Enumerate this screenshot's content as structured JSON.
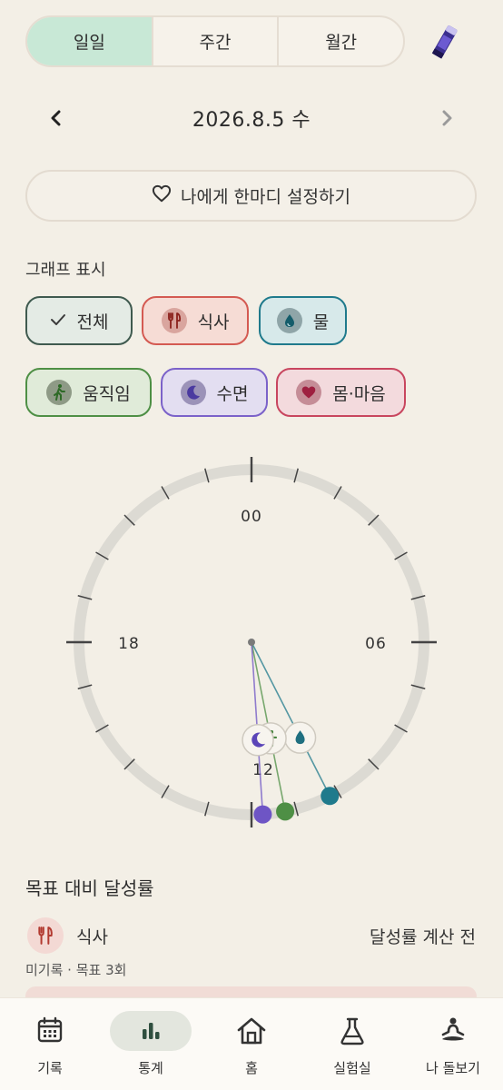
{
  "period_tabs": [
    {
      "label": "일일",
      "active": true
    },
    {
      "label": "주간",
      "active": false
    },
    {
      "label": "월간",
      "active": false
    }
  ],
  "date": {
    "text": "2026.8.5 수",
    "prev_icon": "chevron-left-icon",
    "next_icon": "chevron-right-icon"
  },
  "message_button": {
    "label": "나에게 한마디 설정하기",
    "icon": "heart-outline-icon"
  },
  "graph_filter": {
    "title": "그래프 표시",
    "chips": [
      {
        "label": "전체",
        "icon": "check-icon",
        "color": "#3f5a4f"
      },
      {
        "label": "식사",
        "icon": "fork-knife-icon",
        "color": "#d45a52"
      },
      {
        "label": "물",
        "icon": "water-drop-icon",
        "color": "#1f7a8c"
      },
      {
        "label": "움직임",
        "icon": "walking-person-icon",
        "color": "#4e8f45"
      },
      {
        "label": "수면",
        "icon": "moon-icon",
        "color": "#7b62c9"
      },
      {
        "label": "몸·마음",
        "icon": "heart-icon",
        "color": "#c8465f"
      }
    ]
  },
  "clock": {
    "labels": {
      "top": "00",
      "right": "06",
      "bottom": "12",
      "left": "18"
    },
    "colors": {
      "track": "#dcdad3",
      "tick": "#444444"
    },
    "markers": [
      {
        "name": "water",
        "hour": 10.2,
        "color": "#1f7a8c",
        "icon": "water-drop-icon"
      },
      {
        "name": "move",
        "hour": 11.25,
        "color": "#4e8f45",
        "icon": "walking-person-icon"
      },
      {
        "name": "sleep",
        "hour": 11.75,
        "color": "#6e55c5",
        "icon": "moon-icon"
      }
    ]
  },
  "goal": {
    "title": "목표 대비 달성률",
    "item_name": "식사",
    "status": "달성률 계산 전",
    "sub": "미기록 · 목표 3회",
    "progress": 0,
    "icon": "fork-knife-icon"
  },
  "tabbar": [
    {
      "label": "기록",
      "icon": "calendar-icon",
      "active": false
    },
    {
      "label": "통계",
      "icon": "bar-chart-icon",
      "active": true
    },
    {
      "label": "홈",
      "icon": "home-icon",
      "active": false
    },
    {
      "label": "실험실",
      "icon": "flask-icon",
      "active": false
    },
    {
      "label": "나 돌보기",
      "icon": "meditation-icon",
      "active": false
    }
  ]
}
